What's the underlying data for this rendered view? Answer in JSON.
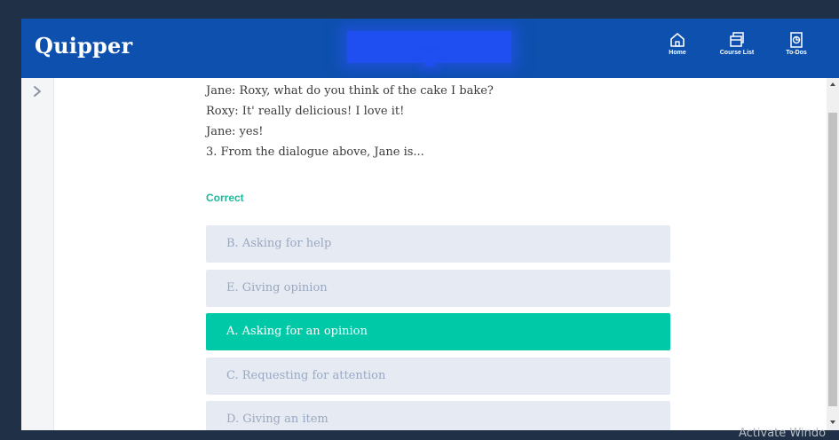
{
  "app": {
    "logo": "Quipper"
  },
  "nav": [
    {
      "label": "Home",
      "icon": "home-icon"
    },
    {
      "label": "Course List",
      "icon": "course-list-icon"
    },
    {
      "label": "To-Dos",
      "icon": "todo-icon"
    }
  ],
  "question": {
    "lines": [
      "Jane: Roxy, what do you think of the cake I bake?",
      "Roxy: It' really delicious! I love it!",
      "Jane: yes!",
      "3. From the dialogue above, Jane is..."
    ],
    "result": "Correct",
    "options": [
      {
        "label": "B. Asking for help",
        "selected": false
      },
      {
        "label": "E. Giving opinion",
        "selected": false
      },
      {
        "label": "A. Asking for an opinion",
        "selected": true
      },
      {
        "label": "C. Requesting for attention",
        "selected": false
      },
      {
        "label": "D. Giving an item",
        "selected": false
      }
    ]
  },
  "watermark": "Activate Windo",
  "colors": {
    "topbar": "#0d50ad",
    "accent": "#00c9a7",
    "correct_text": "#1fb99a",
    "option_bg": "#e6ebf3"
  }
}
